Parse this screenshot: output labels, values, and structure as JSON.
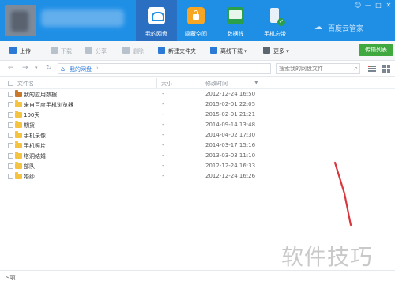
{
  "header": {
    "tabs": [
      {
        "label": "我的网盘",
        "icon": "cloud-drive-icon",
        "active": true
      },
      {
        "label": "隐藏空间",
        "icon": "lock-icon",
        "active": false
      },
      {
        "label": "数据线",
        "icon": "monitor-icon",
        "active": false
      },
      {
        "label": "手机忘带",
        "icon": "phone-icon",
        "active": false
      }
    ],
    "brand": "百度云管家",
    "window_controls": [
      "☺",
      "—",
      "□",
      "✕"
    ]
  },
  "toolbar": {
    "upload": "上传",
    "download": "下载",
    "share": "分享",
    "delete": "删除",
    "new_folder": "新建文件夹",
    "offline_download": "离线下载",
    "more": "更多",
    "transfer_list": "传输列表"
  },
  "address": {
    "back": "←",
    "forward": "→",
    "dropdown": "▾",
    "refresh": "↻",
    "crumb": "我的网盘",
    "crumb_arrow": "›",
    "search_placeholder": "搜索我的网盘文件"
  },
  "columns": {
    "name": "文件名",
    "size": "大小",
    "modified": "修改时间",
    "sort_indicator": "▼"
  },
  "files": [
    {
      "name": "我的应用数据",
      "size": "-",
      "modified": "2012-12-24 16:50",
      "type": "app-folder"
    },
    {
      "name": "来自百度手机浏览器",
      "size": "-",
      "modified": "2015-02-01 22:05",
      "type": "folder"
    },
    {
      "name": "100天",
      "size": "-",
      "modified": "2015-02-01 21:21",
      "type": "folder"
    },
    {
      "name": "期货",
      "size": "-",
      "modified": "2014-09-14 13:48",
      "type": "folder"
    },
    {
      "name": "手机录像",
      "size": "-",
      "modified": "2014-04-02 17:30",
      "type": "folder"
    },
    {
      "name": "手机照片",
      "size": "-",
      "modified": "2014-03-17 15:16",
      "type": "folder"
    },
    {
      "name": "塔洞结婚",
      "size": "-",
      "modified": "2013-03-03 11:10",
      "type": "folder"
    },
    {
      "name": "部队",
      "size": "-",
      "modified": "2012-12-24 16:33",
      "type": "folder"
    },
    {
      "name": "婚纱",
      "size": "-",
      "modified": "2012-12-24 16:26",
      "type": "folder"
    }
  ],
  "status": {
    "count": "9项"
  },
  "watermark": "软件技巧",
  "colors": {
    "titlebar": "#1f8fe6",
    "active_tab": "#2b6fc2",
    "transfer_button": "#3fa83f",
    "folder": "#f5c342",
    "annotation": "#d9363e"
  }
}
